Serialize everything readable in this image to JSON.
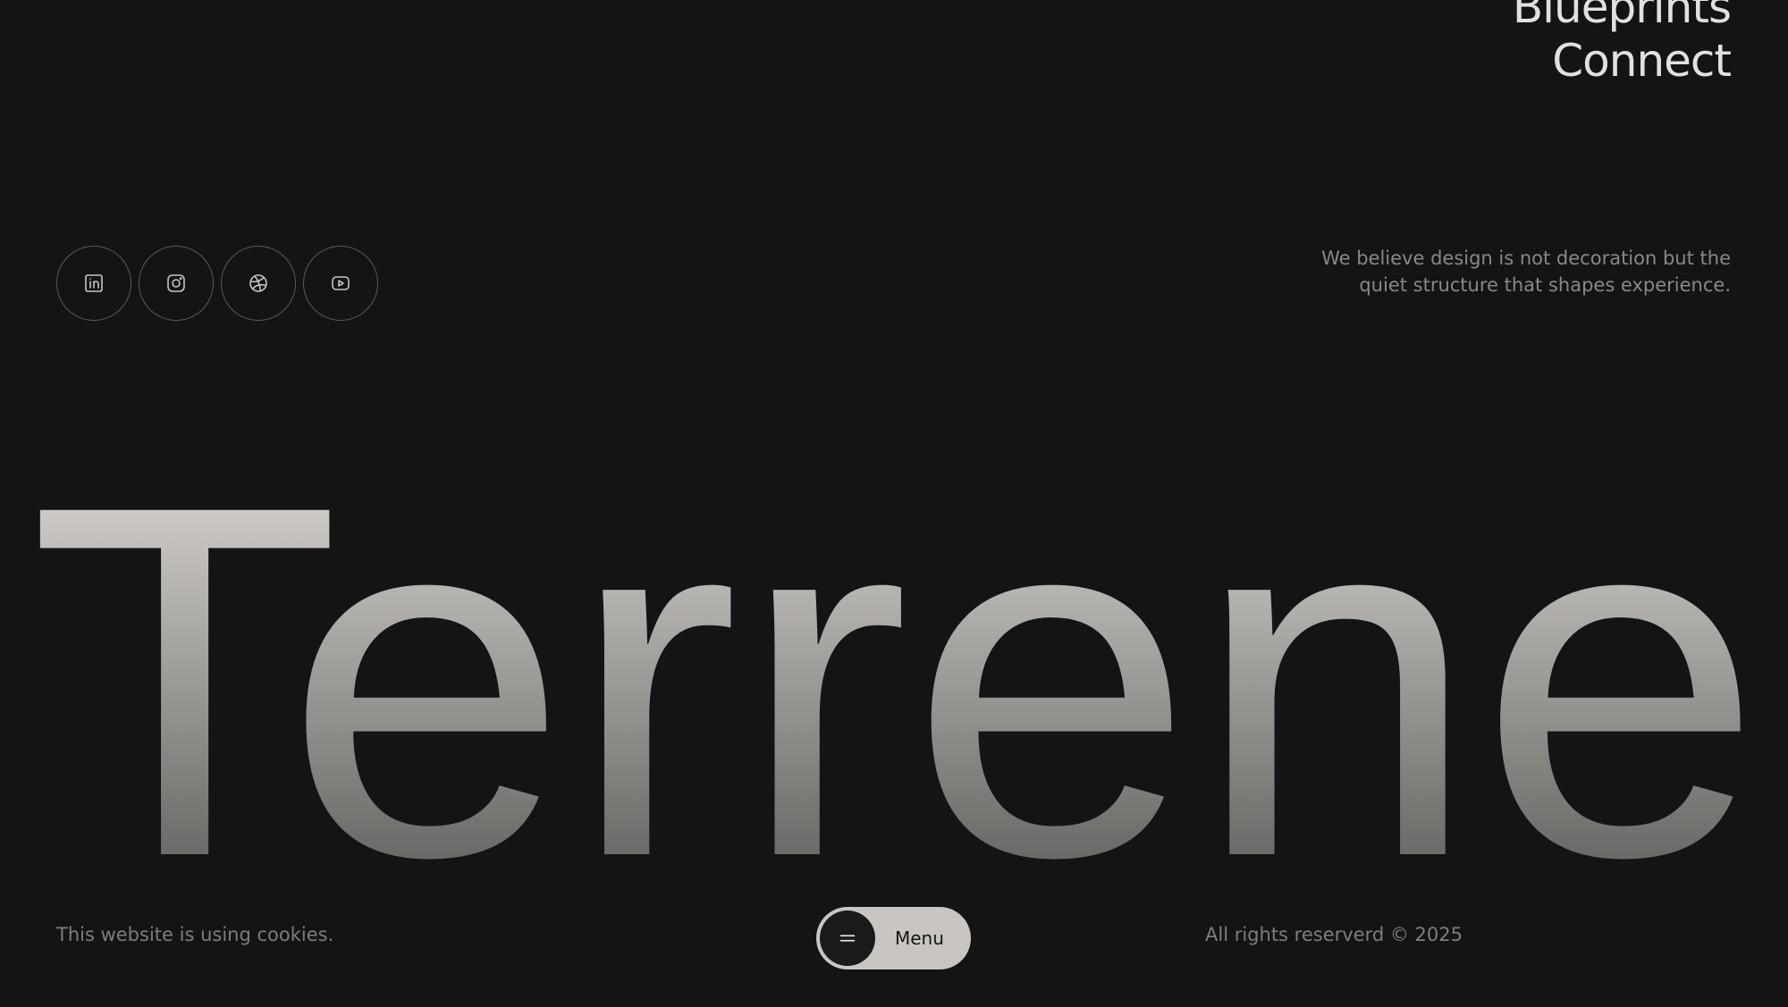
{
  "nav": {
    "items": [
      {
        "label": "Blueprints"
      },
      {
        "label": "Connect"
      }
    ]
  },
  "socials": [
    {
      "icon": "linkedin-icon"
    },
    {
      "icon": "instagram-icon"
    },
    {
      "icon": "dribbble-icon"
    },
    {
      "icon": "youtube-icon"
    }
  ],
  "tagline": {
    "line1": "We believe design is not decoration but the",
    "line2": "quiet structure that shapes experience."
  },
  "brand": {
    "wordmark": "Terrene",
    "gradient_top": "#ebe8e3",
    "gradient_bottom": "#4e4d4b"
  },
  "footer": {
    "cookies_text": "This website is using cookies.",
    "menu_label": "Menu",
    "rights_text": "All rights reserverd © 2025"
  },
  "colors": {
    "background": "#141414",
    "nav_text": "#e3e1dd",
    "muted_text": "#807d78",
    "menu_pill": "#c9c6c1"
  }
}
